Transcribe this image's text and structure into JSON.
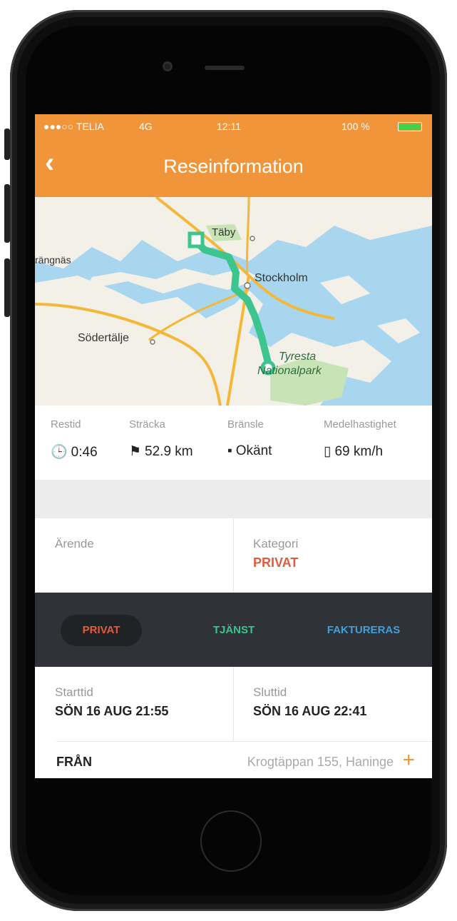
{
  "status": {
    "carrier": "●●●○○ TELIA",
    "network": "4G",
    "time": "12:11",
    "battery_pct": "100 %",
    "battery_level": 1.0
  },
  "nav": {
    "back_icon": "chevron-left-icon",
    "title": "Reseinformation"
  },
  "map": {
    "labels": {
      "taby": "Täby",
      "rangnas": "rängnäs",
      "stockholm": "Stockholm",
      "sodertalje": "Södertälje",
      "tyresta1": "Tyresta",
      "tyresta2": "Nationalpark"
    },
    "colors": {
      "water": "#a9d6ef",
      "land": "#f3f0e8",
      "route": "#3cc58f",
      "road": "#f3b83a",
      "park": "#c8e3b5"
    }
  },
  "stats": [
    {
      "label": "Restid",
      "icon": "clock-icon",
      "glyph": "🕒",
      "value": "0:46"
    },
    {
      "label": "Sträcka",
      "icon": "flag-icon",
      "glyph": "⚑",
      "value": "52.9 km"
    },
    {
      "label": "Bränsle",
      "icon": "fuel-icon",
      "glyph": "▪",
      "value": "Okänt"
    },
    {
      "label": "Medelhastighet",
      "icon": "speedometer-icon",
      "glyph": "▯",
      "value": "69 km/h"
    }
  ],
  "errand": {
    "label": "Ärende",
    "value": ""
  },
  "category": {
    "label": "Kategori",
    "value": "PRIVAT"
  },
  "segment": {
    "options": [
      {
        "label": "PRIVAT",
        "color": "#e25c3c"
      },
      {
        "label": "TJÄNST",
        "color": "#3cc58f"
      },
      {
        "label": "FAKTURERAS",
        "color": "#3f9fd8"
      }
    ],
    "selected": "PRIVAT"
  },
  "start": {
    "label": "Starttid",
    "value": "SÖN 16 AUG 21:55"
  },
  "end": {
    "label": "Sluttid",
    "value": "SÖN 16 AUG 22:41"
  },
  "from": {
    "label": "FRÅN",
    "address": "Krogtäppan 155, Haninge",
    "add_icon": "plus-icon",
    "add_glyph": "+"
  }
}
